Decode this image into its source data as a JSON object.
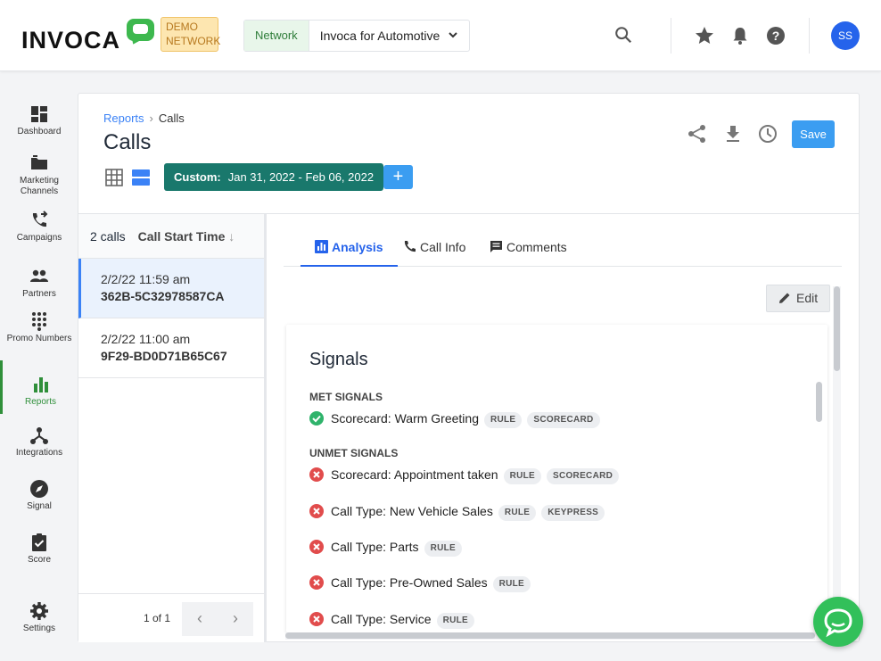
{
  "header": {
    "logo_text": "INVOCA",
    "demo_badge": "DEMO NETWORK",
    "network_label": "Network",
    "network_value": "Invoca for Automotive",
    "avatar_initials": "SS"
  },
  "sidebar": {
    "items": [
      {
        "label": "Dashboard",
        "icon": "dashboard-icon"
      },
      {
        "label": "Marketing Channels",
        "icon": "folder-icon"
      },
      {
        "label": "Campaigns",
        "icon": "phone-forward-icon"
      },
      {
        "label": "Partners",
        "icon": "people-icon"
      },
      {
        "label": "Promo Numbers",
        "icon": "dialpad-icon"
      },
      {
        "label": "Reports",
        "icon": "bar-chart-icon",
        "active": true
      },
      {
        "label": "Integrations",
        "icon": "hub-icon"
      },
      {
        "label": "Signal",
        "icon": "compass-icon"
      },
      {
        "label": "Score",
        "icon": "clipboard-check-icon"
      },
      {
        "label": "Settings",
        "icon": "gear-icon"
      }
    ]
  },
  "page": {
    "breadcrumb_root": "Reports",
    "breadcrumb_current": "Calls",
    "title": "Calls",
    "date_label": "Custom:",
    "date_range": "Jan 31, 2022 - Feb 06, 2022",
    "add_label": "+",
    "save_label": "Save"
  },
  "calls": {
    "count_label": "2 calls",
    "sort_label": "Call Start Time",
    "rows": [
      {
        "time": "2/2/22 11:59 am",
        "id": "362B-5C32978587CA",
        "selected": true
      },
      {
        "time": "2/2/22 11:00 am",
        "id": "9F29-BD0D71B65C67",
        "selected": false
      }
    ],
    "pager_label": "1 of 1"
  },
  "details": {
    "tabs": [
      {
        "label": "Analysis",
        "active": true
      },
      {
        "label": "Call Info",
        "active": false
      },
      {
        "label": "Comments",
        "active": false
      }
    ],
    "edit_label": "Edit",
    "signals_title": "Signals",
    "met_heading": "MET SIGNALS",
    "unmet_heading": "UNMET SIGNALS",
    "met": [
      {
        "name": "Scorecard: Warm Greeting",
        "tags": [
          "RULE",
          "SCORECARD"
        ]
      }
    ],
    "unmet": [
      {
        "name": "Scorecard: Appointment taken",
        "tags": [
          "RULE",
          "SCORECARD"
        ]
      },
      {
        "name": "Call Type: New Vehicle Sales",
        "tags": [
          "RULE",
          "KEYPRESS"
        ]
      },
      {
        "name": "Call Type: Parts",
        "tags": [
          "RULE"
        ]
      },
      {
        "name": "Call Type: Pre-Owned Sales",
        "tags": [
          "RULE"
        ]
      },
      {
        "name": "Call Type: Service",
        "tags": [
          "RULE"
        ]
      }
    ]
  },
  "colors": {
    "brand_green": "#3db84e",
    "accent_blue": "#3b9df1",
    "date_chip": "#19786c",
    "met": "#2fb36b",
    "unmet": "#e14c4c"
  }
}
